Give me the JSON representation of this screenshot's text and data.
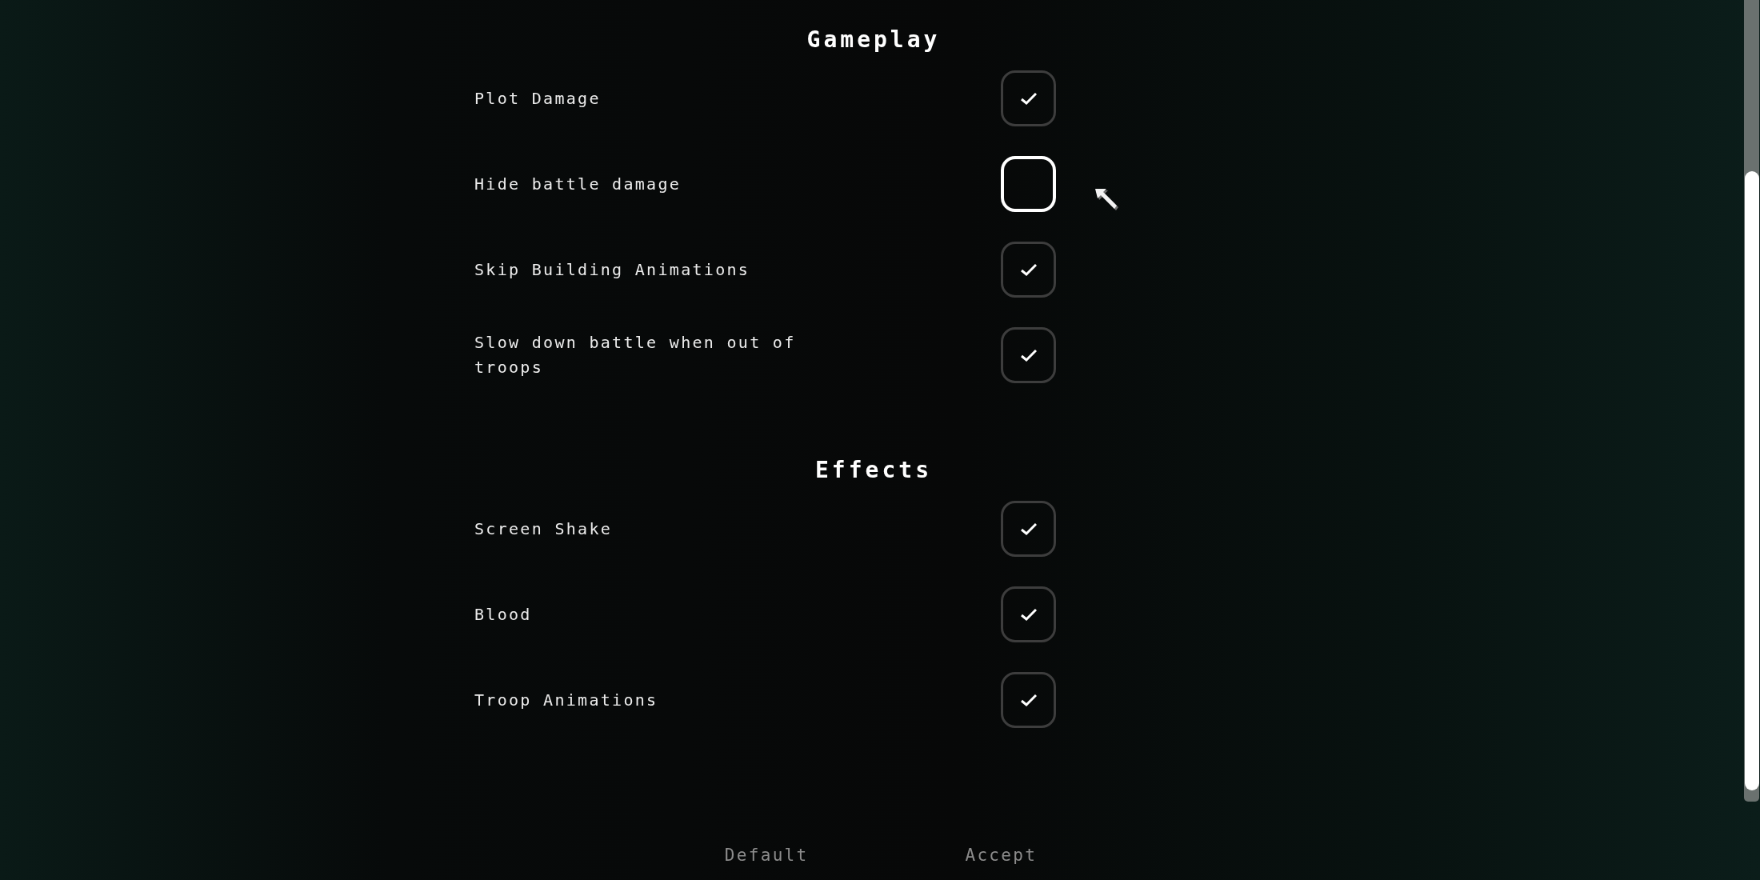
{
  "sections": [
    {
      "title": "Gameplay",
      "options": [
        {
          "label": "Plot Damage",
          "checked": true,
          "highlighted": false
        },
        {
          "label": "Hide battle damage",
          "checked": false,
          "highlighted": true
        },
        {
          "label": "Skip Building Animations",
          "checked": true,
          "highlighted": false
        },
        {
          "label": "Slow down battle when out of troops",
          "checked": true,
          "highlighted": false
        }
      ]
    },
    {
      "title": "Effects",
      "options": [
        {
          "label": "Screen Shake",
          "checked": true,
          "highlighted": false
        },
        {
          "label": "Blood",
          "checked": true,
          "highlighted": false
        },
        {
          "label": "Troop Animations",
          "checked": true,
          "highlighted": false
        }
      ]
    }
  ],
  "buttons": [
    {
      "label": "Default"
    },
    {
      "label": "Accept"
    }
  ]
}
